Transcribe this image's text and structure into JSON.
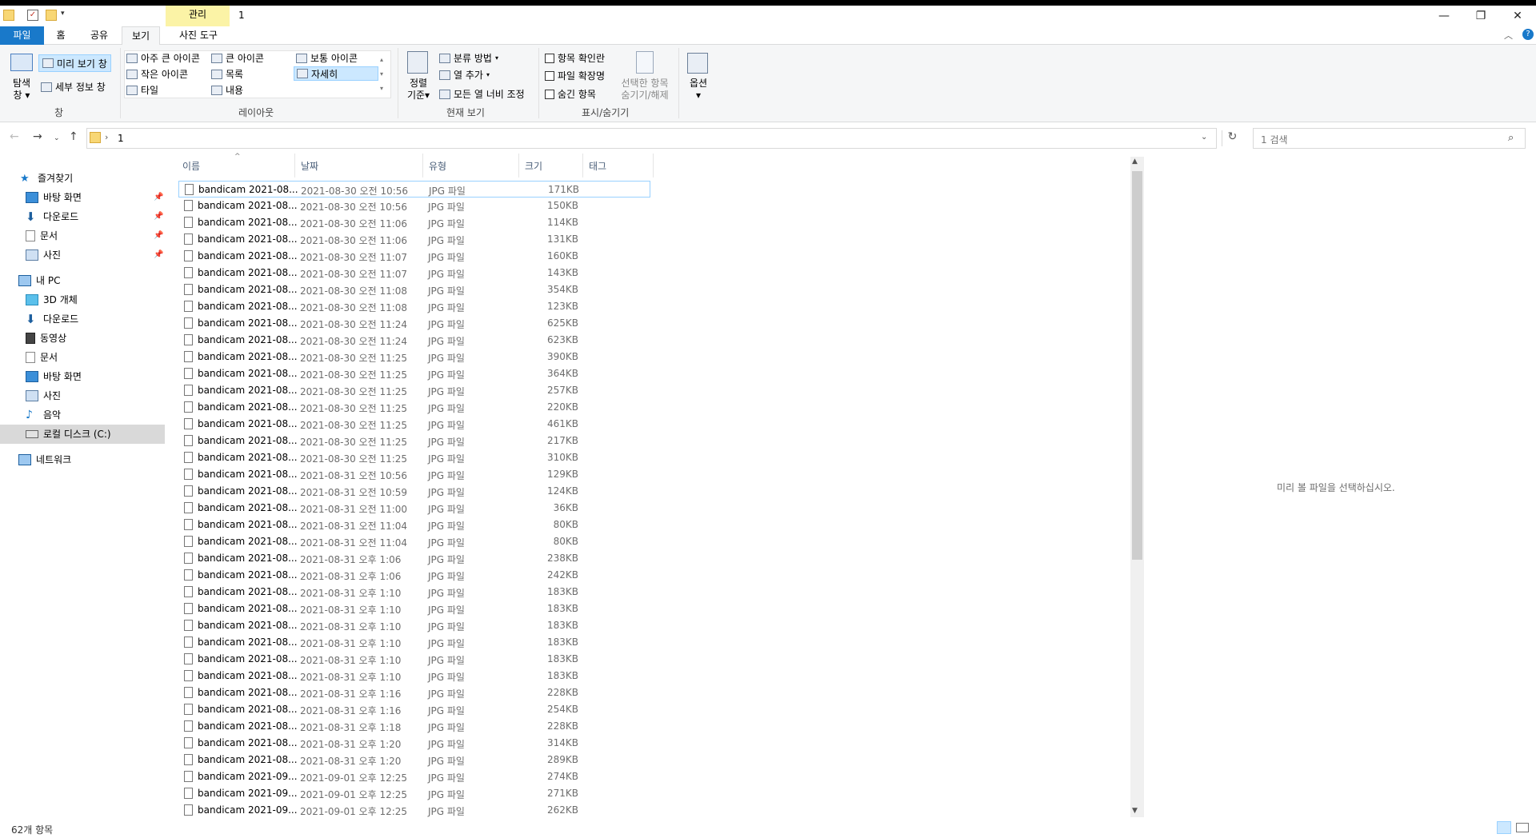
{
  "window": {
    "title": "1",
    "manage_tab": "관리",
    "minimize": "—",
    "maximize": "❐",
    "close": "✕"
  },
  "tabs": {
    "file": "파일",
    "home": "홈",
    "share": "공유",
    "view": "보기",
    "photo_tools": "사진 도구"
  },
  "ribbon": {
    "panes": {
      "nav_pane": "탐색\n창",
      "nav_pane_line1": "탐색",
      "nav_pane_line2": "창",
      "preview_pane": "미리 보기 창",
      "details_pane": "세부 정보 창",
      "group": "창"
    },
    "layout": {
      "extra_large": "아주 큰 아이콘",
      "large": "큰 아이콘",
      "medium": "보통 아이콘",
      "small": "작은 아이콘",
      "list": "목록",
      "details": "자세히",
      "tiles": "타일",
      "content": "내용",
      "group": "레이아웃"
    },
    "current_view": {
      "sort_line1": "정렬",
      "sort_line2": "기준",
      "group_by": "분류 방법",
      "add_columns": "열 추가",
      "size_all": "모든 열 너비 조정",
      "group": "현재 보기"
    },
    "show_hide": {
      "item_checkboxes": "항목 확인란",
      "file_extensions": "파일 확장명",
      "hidden_items": "숨긴 항목",
      "hide_selected_line1": "선택한 항목",
      "hide_selected_line2": "숨기기/해제",
      "group": "표시/숨기기"
    },
    "options": "옵션"
  },
  "address": {
    "path": "1",
    "search_placeholder": "1 검색"
  },
  "sidebar": {
    "quick_access": "즐겨찾기",
    "quick_items": [
      "바탕 화면",
      "다운로드",
      "문서",
      "사진"
    ],
    "this_pc": "내 PC",
    "pc_items": [
      "3D 개체",
      "다운로드",
      "동영상",
      "문서",
      "바탕 화면",
      "사진",
      "음악",
      "로컬 디스크 (C:)"
    ],
    "network": "네트워크"
  },
  "columns": {
    "name": "이름",
    "date": "날짜",
    "type": "유형",
    "size": "크기",
    "tags": "태그"
  },
  "files": [
    {
      "name": "bandicam 2021-08...",
      "date": "2021-08-30 오전 10:56",
      "type": "JPG 파일",
      "size": "171KB"
    },
    {
      "name": "bandicam 2021-08...",
      "date": "2021-08-30 오전 10:56",
      "type": "JPG 파일",
      "size": "150KB"
    },
    {
      "name": "bandicam 2021-08...",
      "date": "2021-08-30 오전 11:06",
      "type": "JPG 파일",
      "size": "114KB"
    },
    {
      "name": "bandicam 2021-08...",
      "date": "2021-08-30 오전 11:06",
      "type": "JPG 파일",
      "size": "131KB"
    },
    {
      "name": "bandicam 2021-08...",
      "date": "2021-08-30 오전 11:07",
      "type": "JPG 파일",
      "size": "160KB"
    },
    {
      "name": "bandicam 2021-08...",
      "date": "2021-08-30 오전 11:07",
      "type": "JPG 파일",
      "size": "143KB"
    },
    {
      "name": "bandicam 2021-08...",
      "date": "2021-08-30 오전 11:08",
      "type": "JPG 파일",
      "size": "354KB"
    },
    {
      "name": "bandicam 2021-08...",
      "date": "2021-08-30 오전 11:08",
      "type": "JPG 파일",
      "size": "123KB"
    },
    {
      "name": "bandicam 2021-08...",
      "date": "2021-08-30 오전 11:24",
      "type": "JPG 파일",
      "size": "625KB"
    },
    {
      "name": "bandicam 2021-08...",
      "date": "2021-08-30 오전 11:24",
      "type": "JPG 파일",
      "size": "623KB"
    },
    {
      "name": "bandicam 2021-08...",
      "date": "2021-08-30 오전 11:25",
      "type": "JPG 파일",
      "size": "390KB"
    },
    {
      "name": "bandicam 2021-08...",
      "date": "2021-08-30 오전 11:25",
      "type": "JPG 파일",
      "size": "364KB"
    },
    {
      "name": "bandicam 2021-08...",
      "date": "2021-08-30 오전 11:25",
      "type": "JPG 파일",
      "size": "257KB"
    },
    {
      "name": "bandicam 2021-08...",
      "date": "2021-08-30 오전 11:25",
      "type": "JPG 파일",
      "size": "220KB"
    },
    {
      "name": "bandicam 2021-08...",
      "date": "2021-08-30 오전 11:25",
      "type": "JPG 파일",
      "size": "461KB"
    },
    {
      "name": "bandicam 2021-08...",
      "date": "2021-08-30 오전 11:25",
      "type": "JPG 파일",
      "size": "217KB"
    },
    {
      "name": "bandicam 2021-08...",
      "date": "2021-08-30 오전 11:25",
      "type": "JPG 파일",
      "size": "310KB"
    },
    {
      "name": "bandicam 2021-08...",
      "date": "2021-08-31 오전 10:56",
      "type": "JPG 파일",
      "size": "129KB"
    },
    {
      "name": "bandicam 2021-08...",
      "date": "2021-08-31 오전 10:59",
      "type": "JPG 파일",
      "size": "124KB"
    },
    {
      "name": "bandicam 2021-08...",
      "date": "2021-08-31 오전 11:00",
      "type": "JPG 파일",
      "size": "36KB"
    },
    {
      "name": "bandicam 2021-08...",
      "date": "2021-08-31 오전 11:04",
      "type": "JPG 파일",
      "size": "80KB"
    },
    {
      "name": "bandicam 2021-08...",
      "date": "2021-08-31 오전 11:04",
      "type": "JPG 파일",
      "size": "80KB"
    },
    {
      "name": "bandicam 2021-08...",
      "date": "2021-08-31 오후 1:06",
      "type": "JPG 파일",
      "size": "238KB"
    },
    {
      "name": "bandicam 2021-08...",
      "date": "2021-08-31 오후 1:06",
      "type": "JPG 파일",
      "size": "242KB"
    },
    {
      "name": "bandicam 2021-08...",
      "date": "2021-08-31 오후 1:10",
      "type": "JPG 파일",
      "size": "183KB"
    },
    {
      "name": "bandicam 2021-08...",
      "date": "2021-08-31 오후 1:10",
      "type": "JPG 파일",
      "size": "183KB"
    },
    {
      "name": "bandicam 2021-08...",
      "date": "2021-08-31 오후 1:10",
      "type": "JPG 파일",
      "size": "183KB"
    },
    {
      "name": "bandicam 2021-08...",
      "date": "2021-08-31 오후 1:10",
      "type": "JPG 파일",
      "size": "183KB"
    },
    {
      "name": "bandicam 2021-08...",
      "date": "2021-08-31 오후 1:10",
      "type": "JPG 파일",
      "size": "183KB"
    },
    {
      "name": "bandicam 2021-08...",
      "date": "2021-08-31 오후 1:10",
      "type": "JPG 파일",
      "size": "183KB"
    },
    {
      "name": "bandicam 2021-08...",
      "date": "2021-08-31 오후 1:16",
      "type": "JPG 파일",
      "size": "228KB"
    },
    {
      "name": "bandicam 2021-08...",
      "date": "2021-08-31 오후 1:16",
      "type": "JPG 파일",
      "size": "254KB"
    },
    {
      "name": "bandicam 2021-08...",
      "date": "2021-08-31 오후 1:18",
      "type": "JPG 파일",
      "size": "228KB"
    },
    {
      "name": "bandicam 2021-08...",
      "date": "2021-08-31 오후 1:20",
      "type": "JPG 파일",
      "size": "314KB"
    },
    {
      "name": "bandicam 2021-08...",
      "date": "2021-08-31 오후 1:20",
      "type": "JPG 파일",
      "size": "289KB"
    },
    {
      "name": "bandicam 2021-09...",
      "date": "2021-09-01 오후 12:25",
      "type": "JPG 파일",
      "size": "274KB"
    },
    {
      "name": "bandicam 2021-09...",
      "date": "2021-09-01 오후 12:25",
      "type": "JPG 파일",
      "size": "271KB"
    },
    {
      "name": "bandicam 2021-09...",
      "date": "2021-09-01 오후 12:25",
      "type": "JPG 파일",
      "size": "262KB"
    }
  ],
  "preview_message": "미리 볼 파일을 선택하십시오.",
  "status": "62개 항목",
  "colors": {
    "accent": "#1979ca",
    "selection": "#cce8ff",
    "manage_tab": "#fbf3a6"
  }
}
